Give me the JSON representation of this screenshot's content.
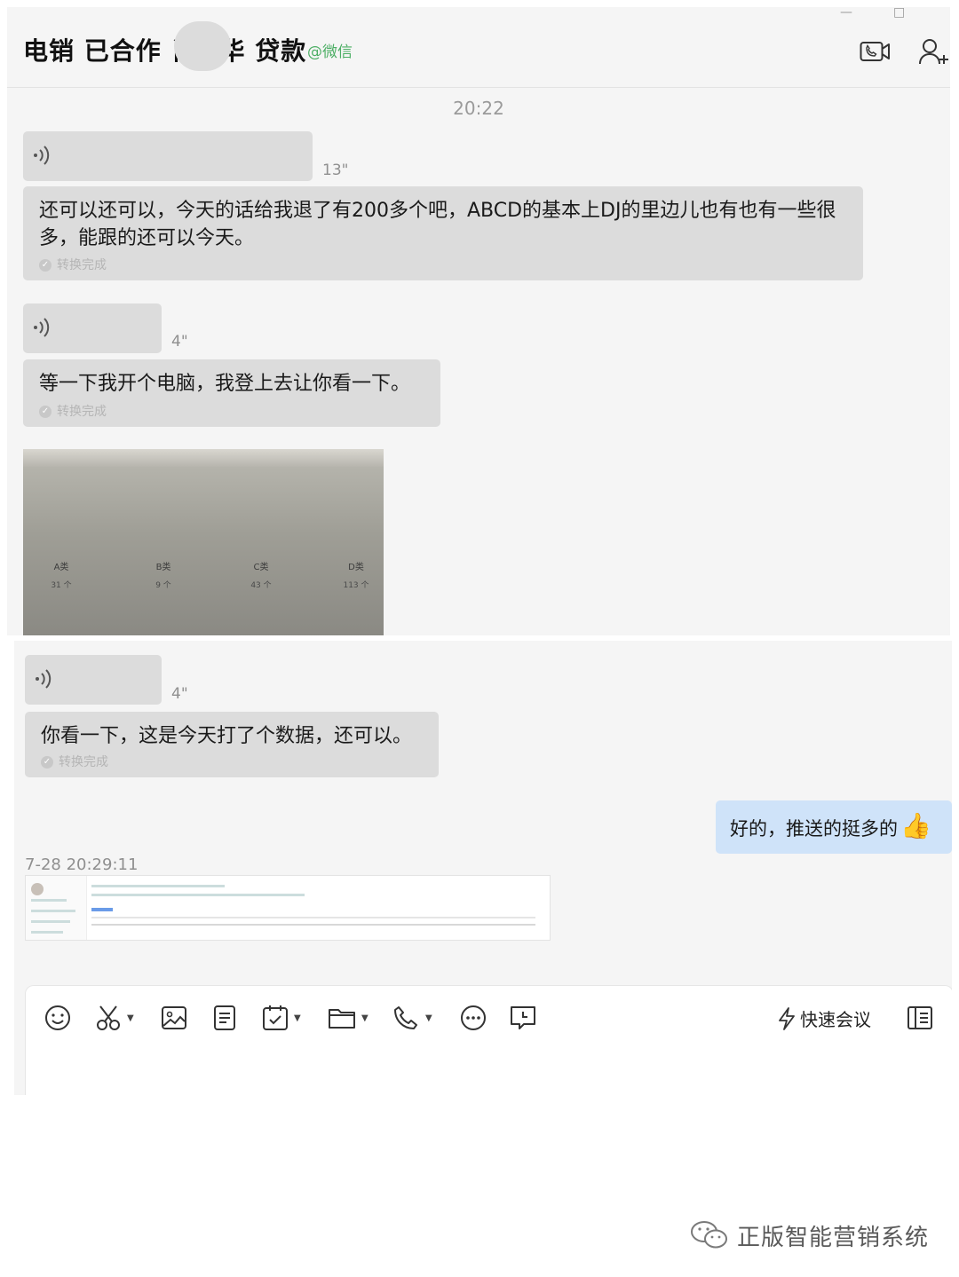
{
  "header": {
    "title_part1": "电销 已合作 肖",
    "title_part2": "华 贷款",
    "source_tag": "@微信",
    "window_minimize": "—",
    "window_maximize": "□",
    "icons": [
      "video-call-icon",
      "add-member-icon"
    ]
  },
  "chat": {
    "timestamp": "20:22",
    "messages": [
      {
        "voice_duration": "13\"",
        "transcript": "还可以还可以，今天的话给我退了有200多个吧，ABCD的基本上DJ的里边儿也有也有一些很多，能跟的还可以今天。",
        "status": "转换完成"
      },
      {
        "voice_duration": "4\"",
        "transcript": "等一下我开个电脑，我登上去让你看一下。",
        "status": "转换完成"
      },
      {
        "voice_duration": "4\"",
        "transcript": "你看一下，这是今天打了个数据，还可以。",
        "status": "转换完成"
      }
    ],
    "photo": {
      "categories": [
        {
          "label": "A类",
          "count": "31 个"
        },
        {
          "label": "B类",
          "count": "9 个"
        },
        {
          "label": "C类",
          "count": "43 个"
        },
        {
          "label": "D类",
          "count": "113 个"
        }
      ]
    },
    "outgoing": {
      "text": "好的，推送的挺多的",
      "emoji": "👍"
    },
    "sent_time": "7-28 20:29:11"
  },
  "toolbar": {
    "quick_meeting_label": "快速会议",
    "tools": [
      "emoji-icon",
      "scissors-icon",
      "image-icon",
      "document-icon",
      "task-icon",
      "folder-icon",
      "phone-icon",
      "more-icon",
      "chat-record-icon"
    ]
  },
  "footer": {
    "brand": "正版智能营销系统",
    "icon": "wechat-official-account-icon"
  }
}
